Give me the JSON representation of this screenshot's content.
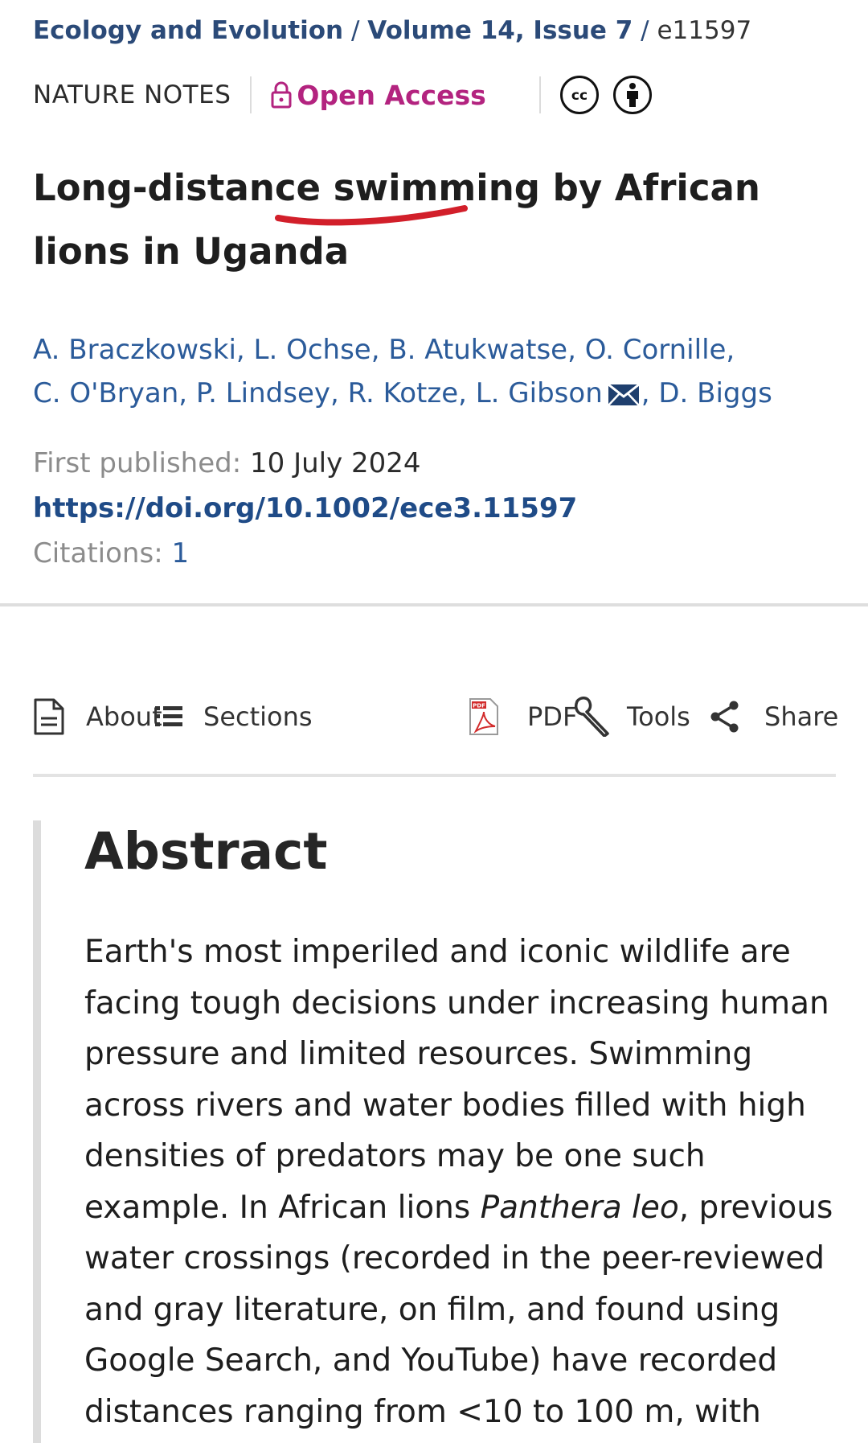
{
  "breadcrumb": {
    "journal": "Ecology and Evolution",
    "separator": "/",
    "volume_issue": "Volume 14, Issue 7",
    "article_id": "e11597"
  },
  "meta": {
    "article_type": "NATURE NOTES",
    "open_access": "Open Access",
    "license_icons": [
      "cc-icon",
      "by-attribution-icon"
    ]
  },
  "article": {
    "title": "Long-distance swimming by African lions in Uganda",
    "title_parts": {
      "before": "Long-distance ",
      "highlight": "swimming",
      "after": " by African lions in Uganda"
    },
    "authors": [
      "A. Braczkowski",
      "L. Ochse",
      "B. Atukwatse",
      "O. Cornille",
      "C. O'Bryan",
      "P. Lindsey",
      "R. Kotze",
      "L. Gibson",
      "D. Biggs"
    ],
    "authors_line1": "A. Braczkowski, L. Ochse, B. Atukwatse, O. Cornille,",
    "authors_line2_start": "C. O'Bryan, P. Lindsey, R. Kotze, L. Gibson",
    "authors_line2_end": ", D. Biggs",
    "published_label": "First published:",
    "published_date": "10 July 2024",
    "doi": "https://doi.org/10.1002/ece3.11597",
    "citations_label": "Citations:",
    "citations_count": "1"
  },
  "toolbar": {
    "about": "About",
    "sections": "Sections",
    "pdf": "PDF",
    "tools": "Tools",
    "share": "Share"
  },
  "abstract": {
    "heading": "Abstract",
    "text_part1": "Earth's most imperiled and iconic wildlife are facing tough decisions under increasing human pressure and limited resources. Swimming across rivers and water bodies filled with high densities of predators may be one such example. In African lions ",
    "species": "Panthera leo",
    "text_part2": ", previous water crossings (recorded in the peer-reviewed and gray literature, on film, and found using Google Search, and YouTube) have recorded distances ranging from <10 to 100 m, with"
  },
  "colors": {
    "link_blue": "#2b4a78",
    "author_blue": "#2b5b9a",
    "open_access_magenta": "#b3237f",
    "annotation_red": "#d21f2a"
  }
}
